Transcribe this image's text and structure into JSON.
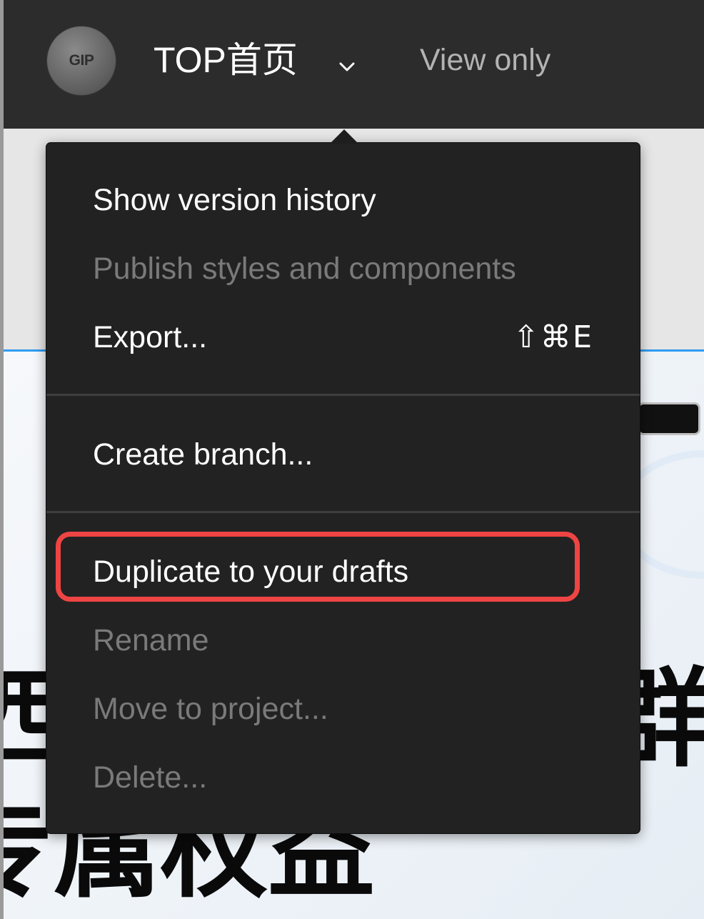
{
  "header": {
    "avatar_initials": "GIP",
    "file_title": "TOP首页",
    "access_label": "View only"
  },
  "menu": {
    "items": [
      {
        "label": "Show version history",
        "enabled": true
      },
      {
        "label": "Publish styles and components",
        "enabled": false
      },
      {
        "label": "Export...",
        "shortcut": "⇧⌘E",
        "enabled": true
      },
      {
        "label": "Create branch...",
        "enabled": true
      },
      {
        "label": "Duplicate to your drafts",
        "enabled": true,
        "highlighted": true
      },
      {
        "label": "Rename",
        "enabled": false
      },
      {
        "label": "Move to project...",
        "enabled": false
      },
      {
        "label": "Delete...",
        "enabled": false
      }
    ]
  },
  "canvas": {
    "fragment_left_top": "西",
    "fragment_right_top": "群",
    "fragment_bottom": "专属权益"
  },
  "colors": {
    "topbar": "#2c2c2c",
    "menu_background": "#222222",
    "enabled_text": "#ffffff",
    "disabled_text": "#7a7a7a",
    "highlight_border": "#ef4444",
    "canvas_accent_line": "#2f9cf0"
  },
  "icons": {
    "file_menu_toggle": "chevron-down-icon"
  }
}
